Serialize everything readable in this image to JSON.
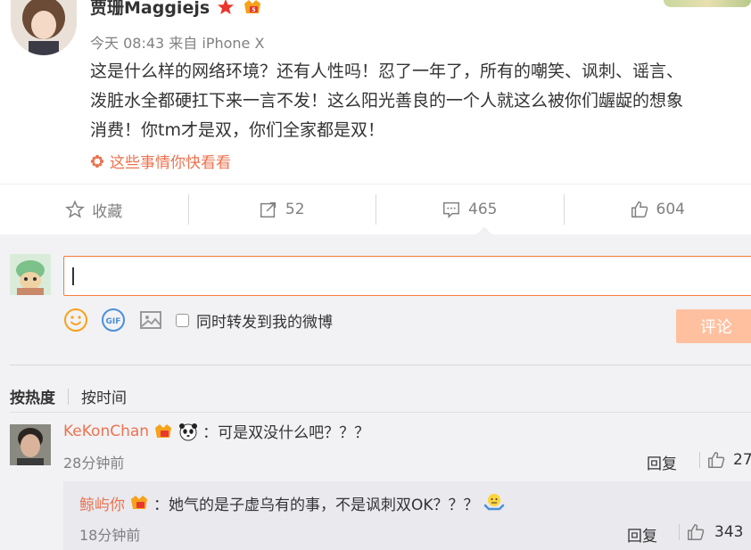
{
  "post": {
    "author": "贾珊Maggiejs",
    "meta": "今天 08:43 来自 iPhone X",
    "lines": [
      "这是什么样的网络环境？还有人性吗！忍了一年了，所有的嘲笑、讽刺、谣言、",
      "泼脏水全都硬扛下来一言不发！这么阳光善良的一个人就这么被你们龌龊的想象",
      "消费！你tm才是双，你们全家都是双！"
    ],
    "related_link": "这些事情你快看看"
  },
  "actions": {
    "favorite": "收藏",
    "repost_count": "52",
    "comment_count": "465",
    "like_count": "604"
  },
  "composer": {
    "forward_label": "同时转发到我的微博",
    "submit_label": "评论",
    "gif_label": "GIF"
  },
  "sort": {
    "hot": "按热度",
    "time": "按时间"
  },
  "comments": [
    {
      "name": "KeKonChan",
      "text": "：可是双没什么吧？？？",
      "time": "28分钟前",
      "reply": "回复",
      "likes": "27"
    }
  ],
  "sub_comment": {
    "name": "鲸屿你",
    "text": "：她气的是子虚乌有的事，不是讽刺双OK？？？",
    "time": "18分钟前",
    "reply": "回复",
    "likes": "343"
  },
  "colors": {
    "accent": "#eb7350",
    "input_border": "#fa7d3c",
    "submit_disabled": "#ffc09f",
    "panel_bg": "#f2f2f5"
  }
}
